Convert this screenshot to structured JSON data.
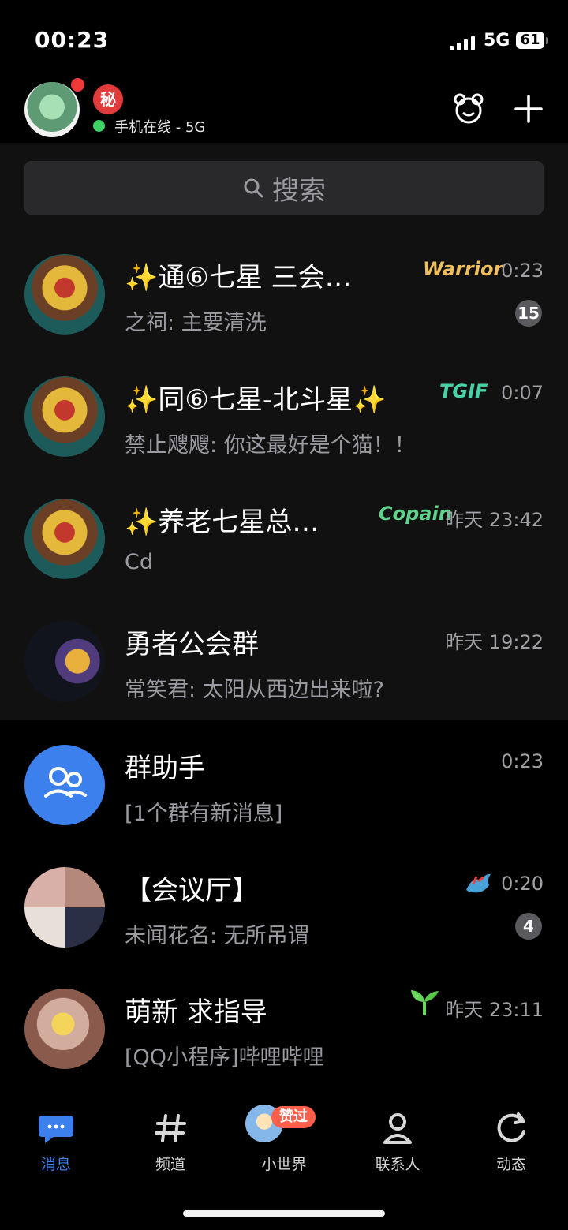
{
  "status_bar": {
    "time": "00:23",
    "network": "5G",
    "battery": "61"
  },
  "header": {
    "secret_badge": "秘",
    "online_status": "手机在线 - 5G"
  },
  "search": {
    "placeholder": "搜索"
  },
  "chats": [
    {
      "title": "✨通⑥七星 三会…",
      "preview": "之祠: 主要清洗",
      "time": "0:23",
      "unread": "15",
      "brand": "Warrior",
      "brand_color": "#f0c060"
    },
    {
      "title": "✨同⑥七星-北斗星✨",
      "preview": "禁止飕飕: 你这最好是个猫！！",
      "time": "0:07",
      "unread": "",
      "brand": "TGIF",
      "brand_color": "#47d3a6"
    },
    {
      "title": "✨养老七星总…",
      "preview": "Cd",
      "time": "昨天 23:42",
      "unread": "",
      "brand": "Copain",
      "brand_color": "#5fd28c"
    },
    {
      "title": "勇者公会群",
      "preview": "常笑君: 太阳从西边出来啦?",
      "time": "昨天 19:22",
      "unread": ""
    },
    {
      "title": "群助手",
      "preview": "[1个群有新消息]",
      "time": "0:23",
      "unread": ""
    },
    {
      "title": "【会议厅】",
      "preview": "未闻花名: 无所吊谓",
      "time": "0:20",
      "unread": "4"
    },
    {
      "title": "萌新 求指导",
      "preview": "[QQ小程序]哔哩哔哩",
      "time": "昨天 23:11",
      "unread": ""
    }
  ],
  "tabs": [
    {
      "label": "消息",
      "icon": "message-icon",
      "active": true
    },
    {
      "label": "频道",
      "icon": "hash-icon",
      "active": false
    },
    {
      "label": "小世界",
      "icon": "avatar-icon",
      "active": false,
      "badge": "赞过"
    },
    {
      "label": "联系人",
      "icon": "contacts-icon",
      "active": false
    },
    {
      "label": "动态",
      "icon": "refresh-icon",
      "active": false
    }
  ],
  "colors": {
    "accent": "#3b80ec",
    "online": "#40d267",
    "alert": "#f03a3a"
  }
}
